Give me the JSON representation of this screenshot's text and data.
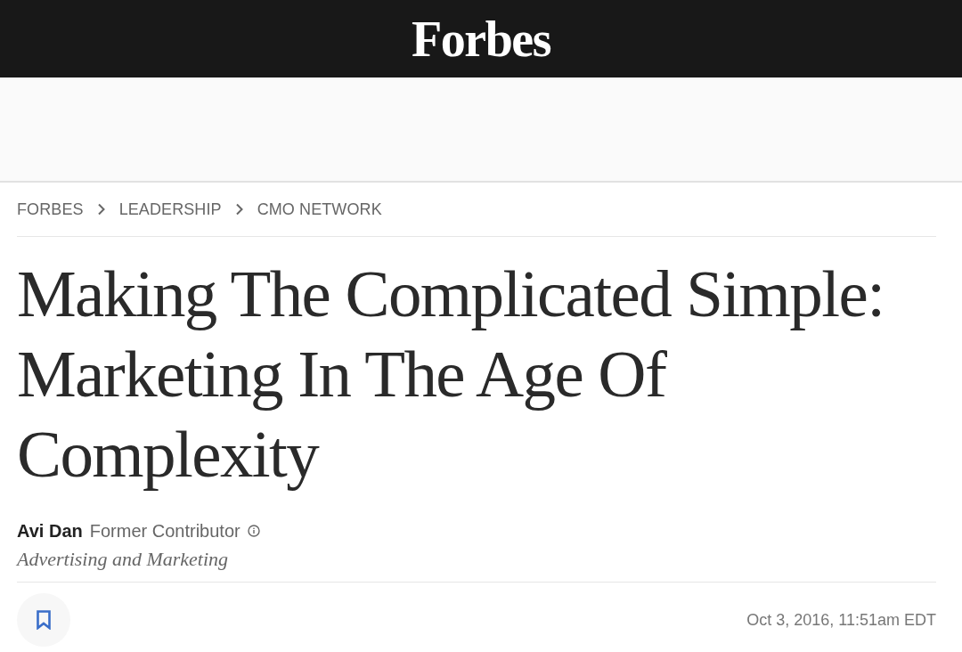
{
  "header": {
    "logo": "Forbes"
  },
  "breadcrumbs": [
    "FORBES",
    "LEADERSHIP",
    "CMO NETWORK"
  ],
  "article": {
    "title": "Making The Complicated Simple: Marketing In The Age Of Complexity",
    "author": {
      "name": "Avi Dan",
      "role": "Former Contributor",
      "section": "Advertising and Marketing"
    },
    "bookmarked": false,
    "published": "Oct 3, 2016, 11:51am EDT"
  }
}
